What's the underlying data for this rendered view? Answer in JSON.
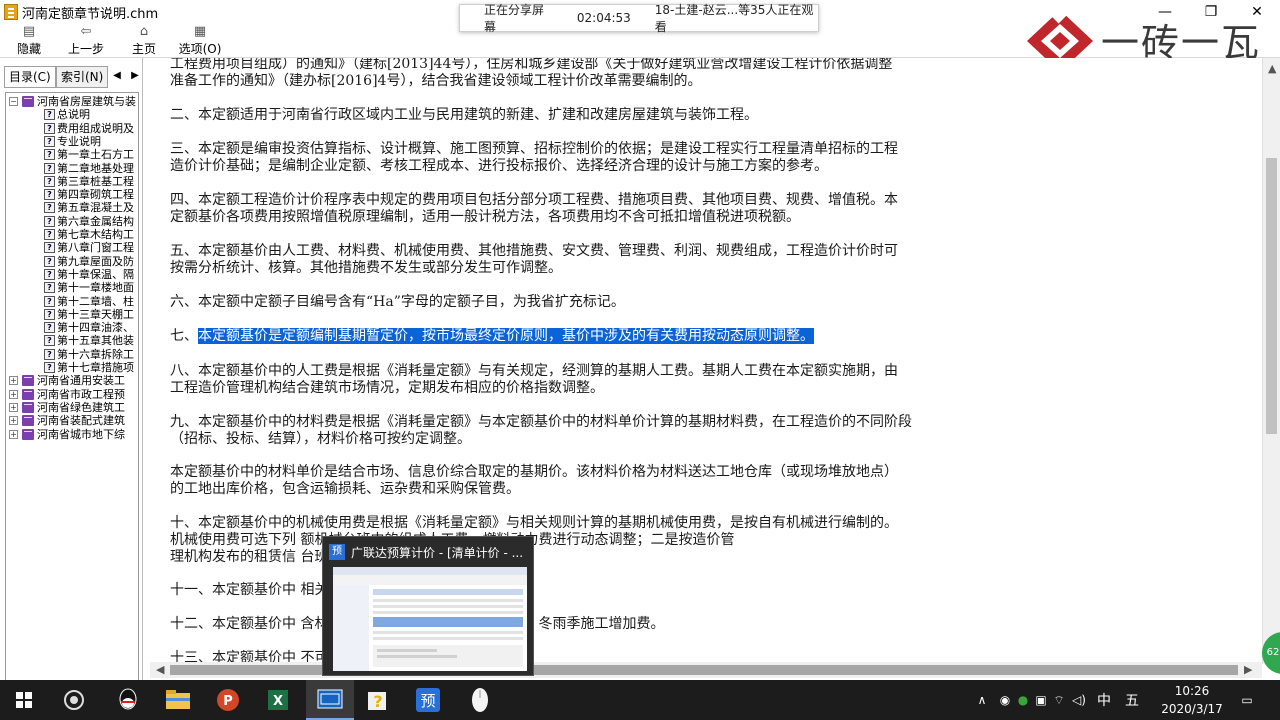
{
  "window": {
    "title": "河南定额章节说明.chm",
    "controls": [
      "—",
      "❐",
      "✕"
    ]
  },
  "share_banner": {
    "status": "正在分享屏幕",
    "timer": "02:04:53",
    "viewers": "18-土建-赵云...等35人正在观看"
  },
  "brand": {
    "text": "一砖一瓦"
  },
  "toolbar": {
    "buttons": [
      {
        "label": "隐藏",
        "icon": "▤"
      },
      {
        "label": "上一步",
        "icon": "⇦"
      },
      {
        "label": "主页",
        "icon": "⌂"
      },
      {
        "label": "选项(O)",
        "icon": "▦"
      }
    ]
  },
  "tabs": {
    "contents": "目录(C)",
    "index": "索引(N)",
    "prev": "◀",
    "next": "▶"
  },
  "tree": {
    "root": "河南省房屋建筑与装",
    "children": [
      "总说明",
      "费用组成说明及",
      "专业说明",
      "第一章土石方工",
      "第二章地基处理",
      "第三章桩基工程",
      "第四章砌筑工程",
      "第五章混凝土及",
      "第六章金属结构",
      "第七章木结构工",
      "第八章门窗工程",
      "第九章屋面及防",
      "第十章保温、隔",
      "第十一章楼地面",
      "第十二章墙、柱",
      "第十三章天棚工",
      "第十四章油漆、",
      "第十五章其他装",
      "第十六章拆除工",
      "第十七章措施项"
    ],
    "siblings": [
      "河南省通用安装工",
      "河南省市政工程预",
      "河南省绿色建筑工",
      "河南省装配式建筑",
      "河南省城市地下综"
    ]
  },
  "content": {
    "paragraphs": [
      {
        "lines": [
          "工程费用项目组成）的通知》（建标[2013]44号），住房和城乡建设部《关于做好建筑业营改增建设工程计价依据调整",
          "准备工作的通知》（建办标[2016]4号），结合我省建设领域工程计价改革需要编制的。"
        ]
      },
      {
        "lines": [
          "二、本定额适用于河南省行政区域内工业与民用建筑的新建、扩建和改建房屋建筑与装饰工程。"
        ]
      },
      {
        "lines": [
          "三、本定额是编审投资估算指标、设计概算、施工图预算、招标控制价的依据；是建设工程实行工程量清单招标的工程",
          "造价计价基础；是编制企业定额、考核工程成本、进行投标报价、选择经济合理的设计与施工方案的参考。"
        ]
      },
      {
        "lines": [
          "四、本定额工程造价计价程序表中规定的费用项目包括分部分项工程费、措施项目费、其他项目费、规费、增值税。本",
          "定额基价各项费用按照增值税原理编制，适用一般计税方法，各项费用均不含可抵扣增值税进项税额。"
        ]
      },
      {
        "lines": [
          "五、本定额基价由人工费、材料费、机械使用费、其他措施费、安文费、管理费、利润、规费组成，工程造价计价时可",
          "按需分析统计、核算。其他措施费不发生或部分发生可作调整。"
        ]
      },
      {
        "lines": [
          "六、本定额中定额子目编号含有“Ha”字母的定额子目，为我省扩充标记。"
        ]
      },
      {
        "prefix": "七、",
        "highlight": "本定额基价是定额编制基期暂定价，按市场最终定价原则，基价中涉及的有关费用按动态原则调整。"
      },
      {
        "lines": [
          "八、本定额基价中的人工费是根据《消耗量定额》与有关规定，经测算的基期人工费。基期人工费在本定额实施期，由",
          "工程造价管理机构结合建筑市场情况，定期发布相应的价格指数调整。"
        ]
      },
      {
        "lines": [
          "九、本定额基价中的材料费是根据《消耗量定额》与本定额基价中的材料单价计算的基期材料费，在工程造价的不同阶段",
          "（招标、投标、结算），材料价格可按约定调整。"
        ]
      },
      {
        "lines": [
          "本定额基价中的材料单价是结合市场、信息价综合取定的基期价。该材料价格为材料送达工地仓库（或现场堆放地点）",
          "的工地出库价格，包含运输损耗、运杂费和采购保管费。"
        ]
      },
      {
        "lines": [
          "十、本定额基价中的机械使用费是根据《消耗量定额》与相关规则计算的基期机械使用费，是按自有机械进行编制的。",
          "机械使用费可选下列                              额机械台班中的组成人工费、燃料动力费进行动态调整；二是按造价管",
          "理机构发布的租赁信                              台班单价调差。"
        ]
      },
      {
        "lines": [
          "十一、本定额基价中                              相关规定实行动态调整。"
        ]
      },
      {
        "lines": [
          "十二、本定额基价中                              含材料二次搬运费、夜间施工增加费、冬雨季施工增加费。"
        ]
      },
      {
        "lines": [
          "十三、本定额基价中                              不可竞争费，按足额计取"
        ]
      }
    ]
  },
  "badge": "62",
  "preview": {
    "title": "广联达预算计价 - [清单计价 - ...",
    "app_icon": "预"
  },
  "taskbar": {
    "items": [
      "start-icon",
      "cortana-icon",
      "qq-icon",
      "powerpoint-icon",
      "excel-icon",
      "glodon-gcl-icon",
      "help-chm-icon",
      "glodon-budget-icon",
      "capture-icon"
    ],
    "ime": "中",
    "ime2": "五",
    "time": "10:26",
    "date": "2020/3/17"
  },
  "colors": {
    "highlight": "#0a64d8",
    "brand_red": "#c0272d",
    "taskbar": "#1c1c1c"
  }
}
